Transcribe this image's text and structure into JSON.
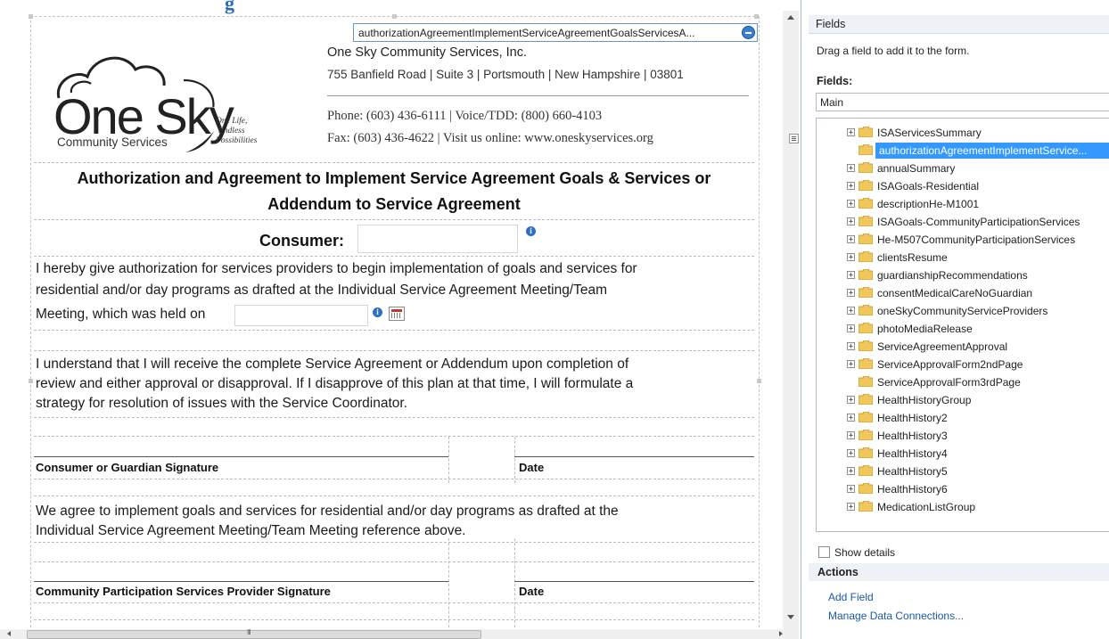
{
  "top_title_fragment": "g",
  "form": {
    "field_tag": "authorizationAgreementImplementServiceAgreementGoalsServicesA...",
    "logo": {
      "brand": "One Sky",
      "brand_sub": "Community Services",
      "tagline": [
        "One Life,",
        "Endless",
        "Possibilities"
      ]
    },
    "org": {
      "name": "One Sky Community Services, Inc.",
      "address": "755 Banfield Road | Suite 3 | Portsmouth | New Hampshire | 03801",
      "phone": "Phone: (603) 436-6111 | Voice/TDD: (800) 660-4103",
      "fax": "Fax: (603) 436-4622 | Visit us online: www.oneskyservices.org"
    },
    "title_line1": "Authorization and Agreement to Implement Service Agreement Goals & Services or",
    "title_line2": "Addendum to Service Agreement",
    "consumer_label": "Consumer:",
    "consumer_value": "",
    "para1": [
      "I hereby give authorization for services providers to begin implementation of goals and services for",
      "residential and/or day programs as drafted at the Individual Service Agreement Meeting/Team",
      "Meeting, which was held on"
    ],
    "meeting_date_value": "",
    "para2": [
      "I understand that I will receive the complete Service Agreement or Addendum upon completion of",
      "review and either approval or disapproval. If I disapprove of this plan at that time, I will formulate a",
      "strategy for resolution of issues with the Service Coordinator."
    ],
    "sig1_label": "Consumer or Guardian Signature",
    "date_label_1": "Date",
    "para3": [
      "We agree to implement goals and services for residential and/or day programs as drafted at the",
      "Individual Service Agreement Meeting/Team Meeting reference above."
    ],
    "sig2_label": "Community Participation Services Provider Signature",
    "date_label_2": "Date",
    "info_glyph": "i",
    "scroll_thumb_glyph": "III"
  },
  "task_pane": {
    "title": "Fields",
    "instruction": "Drag a field to add it to the form.",
    "fields_label": "Fields:",
    "datasource": "Main",
    "tree": [
      {
        "label": "ISAServicesSummary",
        "expand": true,
        "selected": false
      },
      {
        "label": "authorizationAgreementImplementService...",
        "expand": false,
        "selected": true
      },
      {
        "label": "annualSummary",
        "expand": true,
        "selected": false
      },
      {
        "label": "ISAGoals-Residential",
        "expand": true,
        "selected": false
      },
      {
        "label": "descriptionHe-M1001",
        "expand": true,
        "selected": false
      },
      {
        "label": "ISAGoals-CommunityParticipationServices",
        "expand": true,
        "selected": false
      },
      {
        "label": "He-M507CommunityParticipationServices",
        "expand": true,
        "selected": false
      },
      {
        "label": "clientsResume",
        "expand": true,
        "selected": false
      },
      {
        "label": "guardianshipRecommendations",
        "expand": true,
        "selected": false
      },
      {
        "label": "consentMedicalCareNoGuardian",
        "expand": true,
        "selected": false
      },
      {
        "label": "oneSkyCommunityServiceProviders",
        "expand": true,
        "selected": false
      },
      {
        "label": "photoMediaRelease",
        "expand": true,
        "selected": false
      },
      {
        "label": "ServiceAgreementApproval",
        "expand": true,
        "selected": false
      },
      {
        "label": "ServiceApprovalForm2ndPage",
        "expand": true,
        "selected": false
      },
      {
        "label": "ServiceApprovalForm3rdPage",
        "expand": false,
        "selected": false
      },
      {
        "label": "HealthHistoryGroup",
        "expand": true,
        "selected": false
      },
      {
        "label": "HealthHistory2",
        "expand": true,
        "selected": false
      },
      {
        "label": "HealthHistory3",
        "expand": true,
        "selected": false
      },
      {
        "label": "HealthHistory4",
        "expand": true,
        "selected": false
      },
      {
        "label": "HealthHistory5",
        "expand": true,
        "selected": false
      },
      {
        "label": "HealthHistory6",
        "expand": true,
        "selected": false
      },
      {
        "label": "MedicationListGroup",
        "expand": true,
        "selected": false
      }
    ],
    "show_details": "Show details",
    "show_details_checked": false,
    "actions_label": "Actions",
    "add_field": "Add Field",
    "manage_connections": "Manage Data Connections..."
  },
  "colors": {
    "selected_row": "#3399ff",
    "link": "#1a5aa8",
    "pane_header": "#eef2f7",
    "folder": "#f1c75b",
    "accent_title": "#2a6ab8"
  }
}
